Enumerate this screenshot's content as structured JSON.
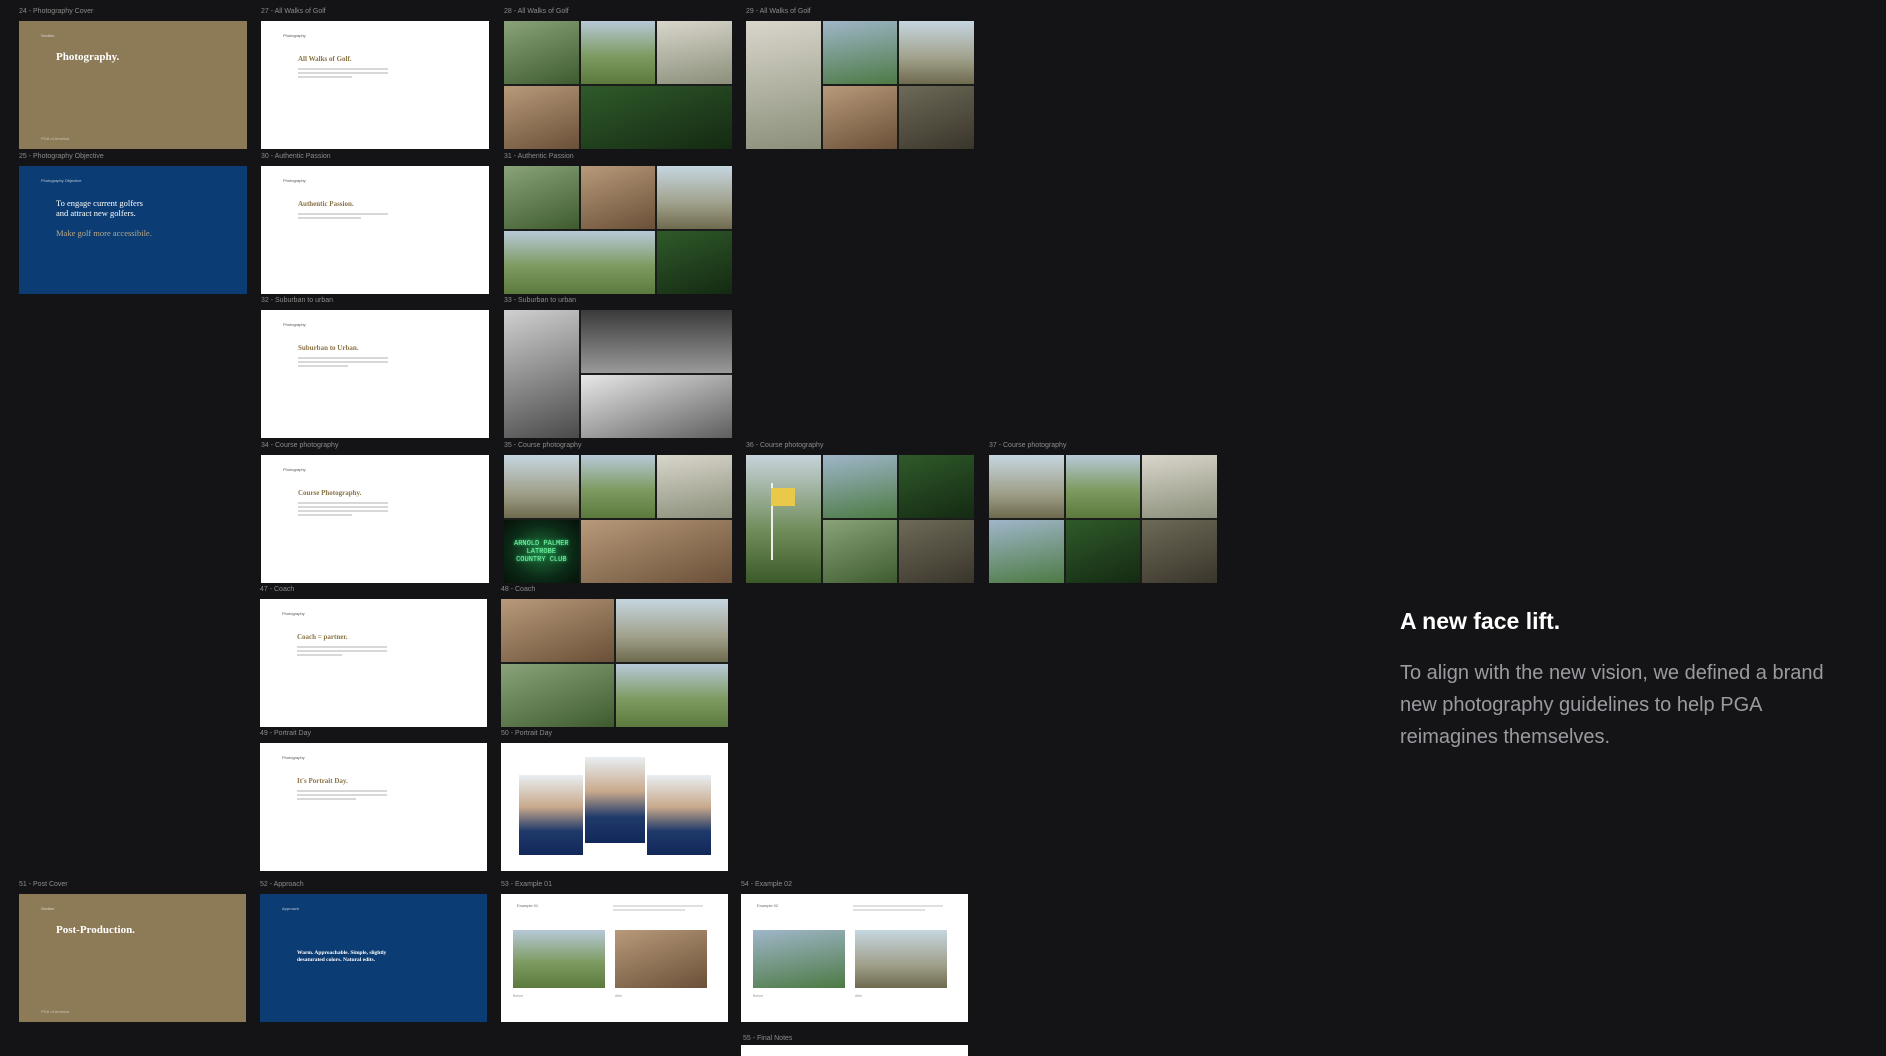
{
  "frames": {
    "f24": {
      "label": "24 - Photography Cover",
      "title": "Photography.",
      "top_tag": "Section",
      "bottom_tag": "PGA of America"
    },
    "f27": {
      "label": "27 - All Walks of Golf",
      "title": "All Walks of Golf.",
      "top_tag": "Photography"
    },
    "f28": {
      "label": "28 - All Walks of Golf"
    },
    "f29": {
      "label": "29 - All Walks of Golf"
    },
    "f25": {
      "label": "25 - Photography Objective",
      "title_l1": "To engage current golfers",
      "title_l2": "and attract new golfers.",
      "sub": "Make golf more accessibile.",
      "top_tag": "Photography Objective"
    },
    "f30": {
      "label": "30 - Authentic Passion",
      "title": "Authentic Passion.",
      "top_tag": "Photography"
    },
    "f31": {
      "label": "31 - Authentic Passion"
    },
    "f32": {
      "label": "32 - Suburban to urban",
      "title": "Suburban to Urban.",
      "top_tag": "Photography"
    },
    "f33": {
      "label": "33 - Suburban to urban"
    },
    "f34": {
      "label": "34 - Course photography",
      "title": "Course Photography.",
      "top_tag": "Photography"
    },
    "f35": {
      "label": "35 - Course photography",
      "neon_l1": "ARNOLD PALMER",
      "neon_l2": "LATROBE",
      "neon_l3": "COUNTRY CLUB"
    },
    "f36": {
      "label": "36 - Course photography"
    },
    "f37": {
      "label": "37 - Course photography"
    },
    "f47": {
      "label": "47 - Coach",
      "title": "Coach = partner.",
      "top_tag": "Photography"
    },
    "f48": {
      "label": "48 - Coach"
    },
    "f49": {
      "label": "49 - Portrait Day",
      "title": "It's Portrait Day.",
      "top_tag": "Photography"
    },
    "f50": {
      "label": "50 - Portrait Day"
    },
    "f51": {
      "label": "51 - Post Cover",
      "title": "Post-Production.",
      "top_tag": "Section",
      "bottom_tag": "PGA of America"
    },
    "f52": {
      "label": "52 - Approach",
      "title_l1": "Warm. Approachable. Simple, slightly",
      "title_l2": "desaturated colors. Natural edits.",
      "top_tag": "Approach"
    },
    "f53": {
      "label": "53 - Example 01",
      "head": "Example 01",
      "cap_a": "Before",
      "cap_b": "After"
    },
    "f54": {
      "label": "54 - Example 02",
      "head": "Example 02",
      "cap_a": "Before",
      "cap_b": "After"
    },
    "f55": {
      "label": "55 - Final Notes"
    }
  },
  "panel": {
    "headline": "A new face lift.",
    "body": "To align with the new vision, we defined a brand new photography guidelines to help PGA reimagines themselves."
  },
  "colors": {
    "background": "#141416",
    "tan": "#8d7a57",
    "navy": "#0b3c73",
    "gold_text": "#8a7346"
  }
}
